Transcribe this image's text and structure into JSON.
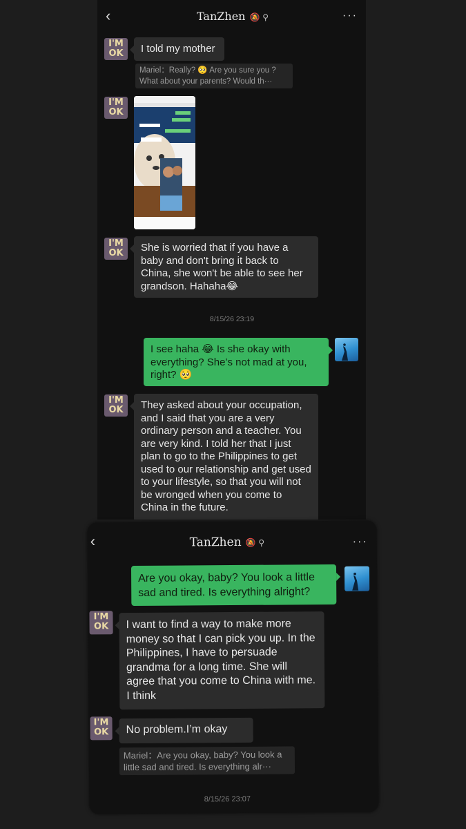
{
  "chat1": {
    "title": "TanZhen",
    "title_icons": "🔕 ⚲",
    "back_glyph": "‹",
    "more_glyph": "···",
    "avatar_line1": "I'M",
    "avatar_line2": "OK",
    "msg1": "I told my mother",
    "quote1": "Mariel：Really? 🥺 Are you sure you ? What about your parents? Would th···",
    "msg3": "She is worried that if you have a baby and don't bring it back to China, she won't be able to see her grandson. Hahaha😂",
    "timestamp": "8/15/26 23:19",
    "msg4": "I see haha 😂 Is she okay with everything? She’s not mad at you, right? 🥺",
    "msg5": "They asked about your occupation, and I said that you are a very ordinary person and a teacher. You are very kind. I told her that I just plan to go to the Philippines to get used to our relationship and get used to your lifestyle, so that you will not be wronged when you come to China in the future."
  },
  "chat2": {
    "title": "TanZhen",
    "title_icons": "🔕 ⚲",
    "back_glyph": "‹",
    "more_glyph": "···",
    "avatar_line1": "I'M",
    "avatar_line2": "OK",
    "msg1": "Are you okay, baby? You look a little sad and tired. Is everything alright?",
    "msg2": "I want to find a way to make more money so that I can pick you up. In the Philippines, I have to persuade grandma for a long time. She will agree that you come to China with me. I think",
    "msg3": "No problem.I’m okay",
    "quote": "Mariel：Are you okay, baby? You look a little sad and tired. Is everything alr···",
    "timestamp": "8/15/26 23:07"
  },
  "colors": {
    "background": "#1d1d1d",
    "panel": "#111111",
    "bubble_received": "#2c2c2c",
    "bubble_sent": "#39b55f",
    "avatar": "#6a5a6e",
    "avatar_text": "#e9d9a4"
  }
}
